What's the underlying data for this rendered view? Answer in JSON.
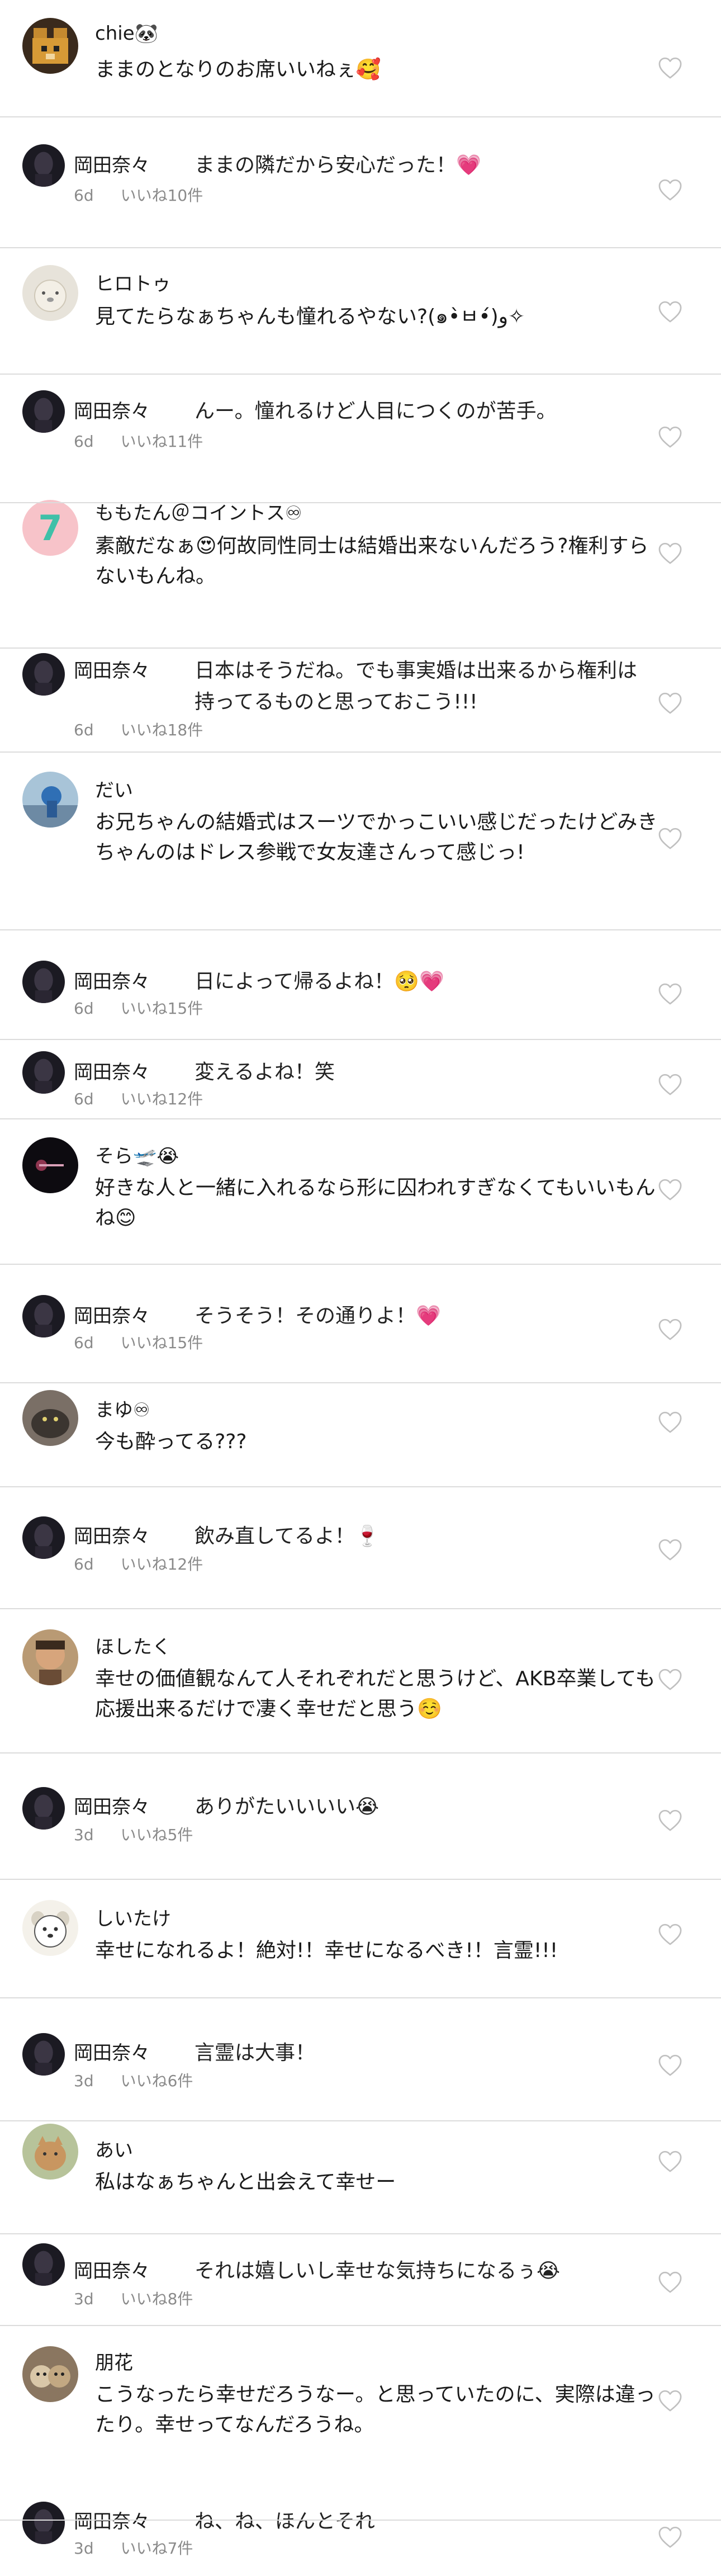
{
  "comments": [
    {
      "type": "comment",
      "name": "chie🐼",
      "text": "ままのとなりのお席いいねぇ🥰",
      "avatar": "pixel-bear"
    },
    {
      "type": "reply",
      "name": "岡田奈々",
      "text": "ままの隣だから安心だった！💗",
      "time": "6d",
      "likes": "いいね10件"
    },
    {
      "type": "comment",
      "name": "ヒロトゥ",
      "text": "見てたらなぁちゃんも憧れるやない?(๑•̀ㅂ•́)و✧",
      "avatar": "bear-face"
    },
    {
      "type": "reply",
      "name": "岡田奈々",
      "text": "んー。憧れるけど人目につくのが苦手。",
      "time": "6d",
      "likes": "いいね11件"
    },
    {
      "type": "comment",
      "name": "ももたん＠コイントス♾",
      "text": "素敵だなぁ😍何故同性同士は結婚出来ないんだろう?権利すらないもんね。",
      "avatar": "number-7"
    },
    {
      "type": "reply",
      "name": "岡田奈々",
      "text": "日本はそうだね。でも事実婚は出来るから権利は持ってるものと思っておこう!!!",
      "time": "6d",
      "likes": "いいね18件"
    },
    {
      "type": "comment",
      "name": "だい",
      "text": "お兄ちゃんの結婚式はスーツでかっこいい感じだったけどみきちゃんのはドレス参戦で女友達さんって感じっ!",
      "avatar": "photo-blue"
    },
    {
      "type": "reply",
      "name": "岡田奈々",
      "text": "日によって帰るよね！🥺💗",
      "time": "6d",
      "likes": "いいね15件"
    },
    {
      "type": "reply",
      "name": "岡田奈々",
      "text": "変えるよね！笑",
      "time": "6d",
      "likes": "いいね12件"
    },
    {
      "type": "comment",
      "name": "そら🛫😭",
      "text": "好きな人と一緒に入れるなら形に囚われすぎなくてもいいもんね😊",
      "avatar": "photo-dark"
    },
    {
      "type": "reply",
      "name": "岡田奈々",
      "text": "そうそう！その通りよ！💗",
      "time": "6d",
      "likes": "いいね15件"
    },
    {
      "type": "comment",
      "name": "まゆ♾",
      "text": "今も酔ってる???",
      "avatar": "photo-cat"
    },
    {
      "type": "reply",
      "name": "岡田奈々",
      "text": "飲み直してるよ！🍷",
      "time": "6d",
      "likes": "いいね12件"
    },
    {
      "type": "comment",
      "name": "ほしたく",
      "text": "幸せの価値観なんて人それぞれだと思うけど、AKB卒業しても応援出来るだけで凄く幸せだと思う☺️",
      "avatar": "photo-face"
    },
    {
      "type": "reply",
      "name": "岡田奈々",
      "text": "ありがたいいいい😭",
      "time": "3d",
      "likes": "いいね5件"
    },
    {
      "type": "comment",
      "name": "しいたけ",
      "text": "幸せになれるよ！絶対!！幸せになるべき!！言霊!!!",
      "avatar": "cartoon-dog"
    },
    {
      "type": "reply",
      "name": "岡田奈々",
      "text": "言霊は大事！",
      "time": "3d",
      "likes": "いいね6件"
    },
    {
      "type": "comment",
      "name": "あい",
      "text": "私はなぁちゃんと出会えて幸せー",
      "avatar": "photo-cat2"
    },
    {
      "type": "reply",
      "name": "岡田奈々",
      "text": "それは嬉しいし幸せな気持ちになるぅ😭",
      "time": "3d",
      "likes": "いいね8件"
    },
    {
      "type": "comment",
      "name": "朋花",
      "text": "こうなったら幸せだろうなー。と思っていたのに、実際は違ったり。幸せってなんだろうね。",
      "avatar": "photo-dogs"
    },
    {
      "type": "reply",
      "name": "岡田奈々",
      "text": "ね、ね、ほんとそれ",
      "time": "3d",
      "likes": "いいね7件"
    }
  ],
  "colors": {
    "heart_stroke": "#c0c0c0",
    "meta_text": "#8a8a8a",
    "separator": "#dcdcdc"
  },
  "icons": {
    "like": "heart-outline-icon"
  }
}
